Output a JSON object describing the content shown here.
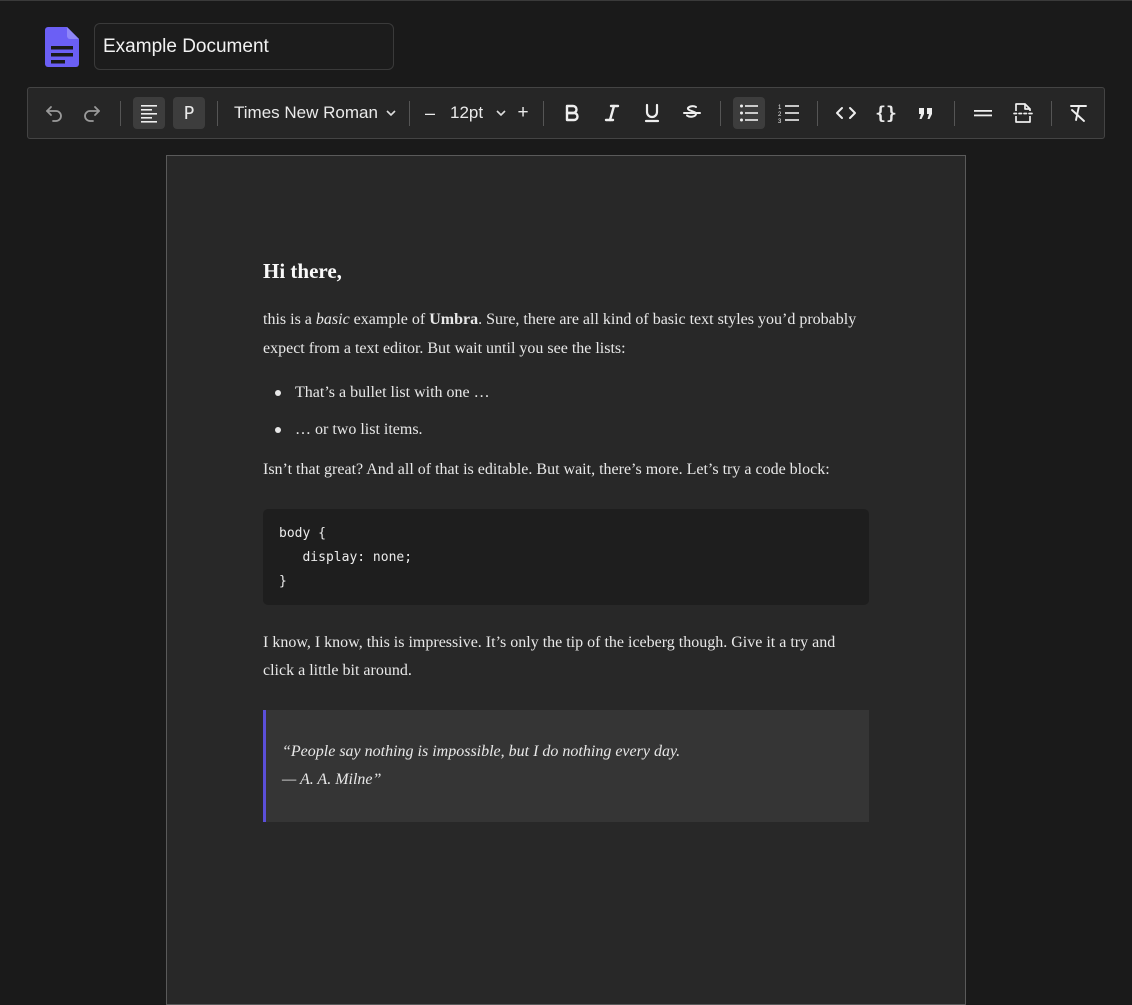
{
  "header": {
    "doc_icon": "document-icon",
    "title_value": "Example Document",
    "accent_color": "#6b5ff5"
  },
  "toolbar": {
    "undo_icon": "undo-icon",
    "redo_icon": "redo-icon",
    "align_icon": "align-left-icon",
    "paragraph_label": "P",
    "font_family": "Times New Roman",
    "font_size": "12pt",
    "decrease_label": "–",
    "increase_label": "+",
    "bold_icon": "bold-icon",
    "italic_icon": "italic-icon",
    "underline_icon": "underline-icon",
    "strike_icon": "strikethrough-icon",
    "bullet_list_icon": "bullet-list-icon",
    "ordered_list_icon": "ordered-list-icon",
    "code_icon": "code-icon",
    "code_block_icon": "code-block-icon",
    "quote_icon": "quote-icon",
    "hr_icon": "horizontal-rule-icon",
    "page_break_icon": "page-break-icon",
    "clear_format_icon": "clear-format-icon"
  },
  "document": {
    "heading": "Hi there,",
    "intro": {
      "a": "this is a ",
      "b_italic": "basic",
      "c": " example of ",
      "d_bold": "Umbra",
      "e": ". Sure, there are all kind of basic text styles you’d probably expect from a text editor. But wait until you see the lists:"
    },
    "bullets": [
      "That’s a bullet list with one …",
      "… or two list items."
    ],
    "para2": "Isn’t that great? And all of that is editable. But wait, there’s more. Let’s try a code block:",
    "code_lines": [
      "body {",
      "   display: none;",
      "}"
    ],
    "para3": "I know, I know, this is impressive. It’s only the tip of the iceberg though. Give it a try and click a little bit around.",
    "quote_line1": "“People say nothing is impossible, but I do nothing every day.",
    "quote_line2": "— A. A. Milne”"
  }
}
